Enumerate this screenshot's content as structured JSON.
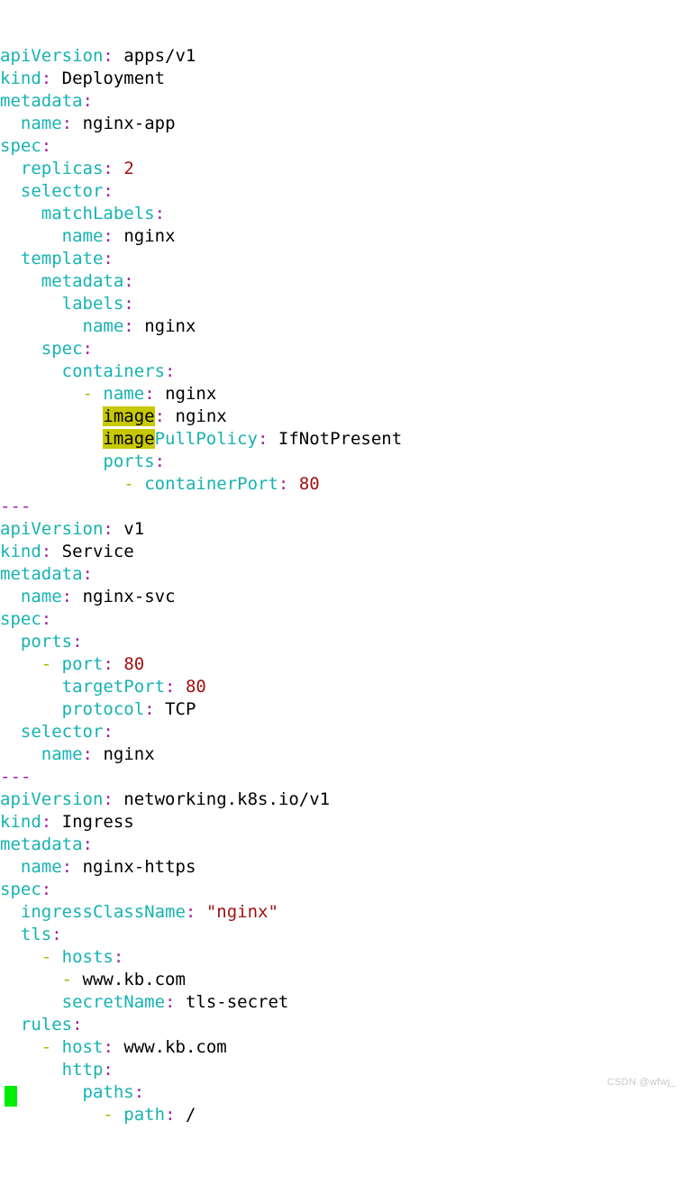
{
  "app": {
    "type": "terminal-text-editor",
    "content_type": "kubernetes-yaml-manifest",
    "background_color": "#ffffff"
  },
  "theme": {
    "key_color": "#17b2b2",
    "punctuation_color": "#a020a0",
    "value_color": "#000000",
    "number_color": "#a01010",
    "dash_color": "#b3b300",
    "separator_color": "#a020a0",
    "highlight_background": "#c8c800",
    "highlight_foreground": "#000000",
    "cursor_color": "#00ee00",
    "watermark_color": "#c8c8c8"
  },
  "cursor": {
    "visible": true,
    "shape": "block",
    "line": 48,
    "column": 0
  },
  "watermark": {
    "text": "CSDN @wfwj_"
  },
  "search_highlight": {
    "term": "image",
    "occurrences": 2
  },
  "document": {
    "lines": [
      {
        "indent": 0,
        "dash": false,
        "key": "apiVersion",
        "colon": true,
        "value": "apps/v1",
        "value_type": "plain"
      },
      {
        "indent": 0,
        "dash": false,
        "key": "kind",
        "colon": true,
        "value": "Deployment",
        "value_type": "plain"
      },
      {
        "indent": 0,
        "dash": false,
        "key": "metadata",
        "colon": true,
        "value": "",
        "value_type": "none"
      },
      {
        "indent": 1,
        "dash": false,
        "key": "name",
        "colon": true,
        "value": "nginx-app",
        "value_type": "plain"
      },
      {
        "indent": 0,
        "dash": false,
        "key": "spec",
        "colon": true,
        "value": "",
        "value_type": "none"
      },
      {
        "indent": 1,
        "dash": false,
        "key": "replicas",
        "colon": true,
        "value": "2",
        "value_type": "number"
      },
      {
        "indent": 1,
        "dash": false,
        "key": "selector",
        "colon": true,
        "value": "",
        "value_type": "none"
      },
      {
        "indent": 2,
        "dash": false,
        "key": "matchLabels",
        "colon": true,
        "value": "",
        "value_type": "none"
      },
      {
        "indent": 3,
        "dash": false,
        "key": "name",
        "colon": true,
        "value": "nginx",
        "value_type": "plain"
      },
      {
        "indent": 1,
        "dash": false,
        "key": "template",
        "colon": true,
        "value": "",
        "value_type": "none"
      },
      {
        "indent": 2,
        "dash": false,
        "key": "metadata",
        "colon": true,
        "value": "",
        "value_type": "none"
      },
      {
        "indent": 3,
        "dash": false,
        "key": "labels",
        "colon": true,
        "value": "",
        "value_type": "none"
      },
      {
        "indent": 4,
        "dash": false,
        "key": "name",
        "colon": true,
        "value": "nginx",
        "value_type": "plain"
      },
      {
        "indent": 2,
        "dash": false,
        "key": "spec",
        "colon": true,
        "value": "",
        "value_type": "none"
      },
      {
        "indent": 3,
        "dash": false,
        "key": "containers",
        "colon": true,
        "value": "",
        "value_type": "none"
      },
      {
        "indent": 4,
        "dash": true,
        "key": "name",
        "colon": true,
        "value": "nginx",
        "value_type": "plain"
      },
      {
        "indent": 5,
        "dash": false,
        "key": "image",
        "colon": true,
        "value": "nginx",
        "value_type": "plain",
        "highlight": "image"
      },
      {
        "indent": 5,
        "dash": false,
        "key": "imagePullPolicy",
        "colon": true,
        "value": "IfNotPresent",
        "value_type": "plain",
        "highlight": "image"
      },
      {
        "indent": 5,
        "dash": false,
        "key": "ports",
        "colon": true,
        "value": "",
        "value_type": "none"
      },
      {
        "indent": 6,
        "dash": true,
        "key": "containerPort",
        "colon": true,
        "value": "80",
        "value_type": "number"
      },
      {
        "indent": 0,
        "dash": false,
        "key": "",
        "colon": false,
        "value": "",
        "value_type": "separator",
        "separator": "---"
      },
      {
        "indent": 0,
        "dash": false,
        "key": "apiVersion",
        "colon": true,
        "value": "v1",
        "value_type": "plain"
      },
      {
        "indent": 0,
        "dash": false,
        "key": "kind",
        "colon": true,
        "value": "Service",
        "value_type": "plain"
      },
      {
        "indent": 0,
        "dash": false,
        "key": "metadata",
        "colon": true,
        "value": "",
        "value_type": "none"
      },
      {
        "indent": 1,
        "dash": false,
        "key": "name",
        "colon": true,
        "value": "nginx-svc",
        "value_type": "plain"
      },
      {
        "indent": 0,
        "dash": false,
        "key": "spec",
        "colon": true,
        "value": "",
        "value_type": "none"
      },
      {
        "indent": 1,
        "dash": false,
        "key": "ports",
        "colon": true,
        "value": "",
        "value_type": "none"
      },
      {
        "indent": 2,
        "dash": true,
        "key": "port",
        "colon": true,
        "value": "80",
        "value_type": "number"
      },
      {
        "indent": 3,
        "dash": false,
        "key": "targetPort",
        "colon": true,
        "value": "80",
        "value_type": "number"
      },
      {
        "indent": 3,
        "dash": false,
        "key": "protocol",
        "colon": true,
        "value": "TCP",
        "value_type": "plain"
      },
      {
        "indent": 1,
        "dash": false,
        "key": "selector",
        "colon": true,
        "value": "",
        "value_type": "none"
      },
      {
        "indent": 2,
        "dash": false,
        "key": "name",
        "colon": true,
        "value": "nginx",
        "value_type": "plain"
      },
      {
        "indent": 0,
        "dash": false,
        "key": "",
        "colon": false,
        "value": "",
        "value_type": "separator",
        "separator": "---"
      },
      {
        "indent": 0,
        "dash": false,
        "key": "apiVersion",
        "colon": true,
        "value": "networking.k8s.io/v1",
        "value_type": "plain"
      },
      {
        "indent": 0,
        "dash": false,
        "key": "kind",
        "colon": true,
        "value": "Ingress",
        "value_type": "plain"
      },
      {
        "indent": 0,
        "dash": false,
        "key": "metadata",
        "colon": true,
        "value": "",
        "value_type": "none"
      },
      {
        "indent": 1,
        "dash": false,
        "key": "name",
        "colon": true,
        "value": "nginx-https",
        "value_type": "plain"
      },
      {
        "indent": 0,
        "dash": false,
        "key": "spec",
        "colon": true,
        "value": "",
        "value_type": "none"
      },
      {
        "indent": 1,
        "dash": false,
        "key": "ingressClassName",
        "colon": true,
        "value": "\"nginx\"",
        "value_type": "number"
      },
      {
        "indent": 1,
        "dash": false,
        "key": "tls",
        "colon": true,
        "value": "",
        "value_type": "none"
      },
      {
        "indent": 2,
        "dash": true,
        "key": "hosts",
        "colon": true,
        "value": "",
        "value_type": "none"
      },
      {
        "indent": 3,
        "dash": true,
        "key": "",
        "colon": false,
        "value": "www.kb.com",
        "value_type": "plain"
      },
      {
        "indent": 3,
        "dash": false,
        "key": "secretName",
        "colon": true,
        "value": "tls-secret",
        "value_type": "plain"
      },
      {
        "indent": 1,
        "dash": false,
        "key": "rules",
        "colon": true,
        "value": "",
        "value_type": "none"
      },
      {
        "indent": 2,
        "dash": true,
        "key": "host",
        "colon": true,
        "value": "www.kb.com",
        "value_type": "plain"
      },
      {
        "indent": 3,
        "dash": false,
        "key": "http",
        "colon": true,
        "value": "",
        "value_type": "none"
      },
      {
        "indent": 4,
        "dash": false,
        "key": "paths",
        "colon": true,
        "value": "",
        "value_type": "none"
      },
      {
        "indent": 5,
        "dash": true,
        "key": "path",
        "colon": true,
        "value": "/",
        "value_type": "plain"
      }
    ]
  }
}
